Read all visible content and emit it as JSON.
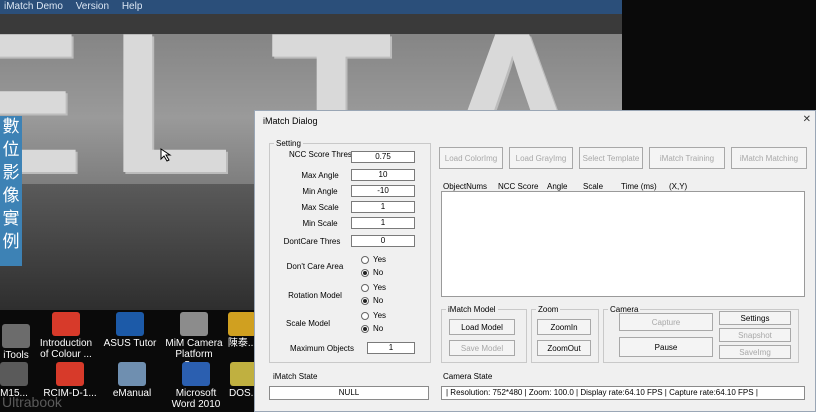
{
  "main_window": {
    "menu": [
      "iMatch Demo",
      "Version",
      "Help"
    ],
    "chinese_banner": [
      "數",
      "位",
      "影",
      "像",
      "實",
      "例"
    ],
    "camera_letters": [
      "E",
      "L",
      "T",
      "A"
    ]
  },
  "desktop": {
    "icons": [
      {
        "label": "iTools"
      },
      {
        "label": "Introduction of Colour ..."
      },
      {
        "label": "ASUS Tutor"
      },
      {
        "label": "MiM Camera Platform Se..."
      },
      {
        "label": "陳泰..."
      },
      {
        "label": "M15..."
      },
      {
        "label": "RCIM-D-1..."
      },
      {
        "label": "eManual"
      },
      {
        "label": "Microsoft Word 2010"
      },
      {
        "label": "DOS..."
      }
    ],
    "brand": "Ultrabook"
  },
  "dialog": {
    "title": "iMatch Dialog",
    "close_glyph": "✕",
    "setting": {
      "legend": "Setting",
      "fields": [
        {
          "label": "NCC Score Threshold",
          "value": "0.75"
        },
        {
          "label": "Max Angle",
          "value": "10"
        },
        {
          "label": "Min Angle",
          "value": "-10"
        },
        {
          "label": "Max Scale",
          "value": "1"
        },
        {
          "label": "Min Scale",
          "value": "1"
        },
        {
          "label": "DontCare Thres",
          "value": "0"
        }
      ],
      "radios": [
        {
          "label": "Don't Care Area",
          "yes": "Yes",
          "no": "No",
          "selected": "No"
        },
        {
          "label": "Rotation Model",
          "yes": "Yes",
          "no": "No",
          "selected": "No"
        },
        {
          "label": "Scale Model",
          "yes": "Yes",
          "no": "No",
          "selected": "No"
        }
      ],
      "max_objects_label": "Maximum Objects",
      "max_objects_value": "1"
    },
    "top_buttons": [
      "Load ColorImg",
      "Load GrayImg",
      "Select Template",
      "iMatch Training",
      "iMatch Matching"
    ],
    "results_headers": [
      "ObjectNums",
      "NCC Score",
      "Angle",
      "Scale",
      "Time (ms)",
      "(X,Y)"
    ],
    "imatch_model": {
      "legend": "iMatch Model",
      "load": "Load Model",
      "save": "Save Model"
    },
    "zoom": {
      "legend": "Zoom",
      "zoom_in": "ZoomIn",
      "zoom_out": "ZoomOut"
    },
    "camera": {
      "legend": "Camera",
      "capture": "Capture",
      "pause": "Pause",
      "settings": "Settings",
      "snapshot": "Snapshot",
      "saveimg": "SaveImg"
    },
    "imatch_state": {
      "label": "iMatch State",
      "value": "NULL"
    },
    "camera_state": {
      "label": "Camera State",
      "value": "| Resolution: 752*480 | Zoom: 100.0 | Display rate:64.10 FPS | Capture rate:64.10 FPS |"
    }
  },
  "colors": {
    "title_bar": "#2b4f7a",
    "chinese_banner": "#3d82b5",
    "dialog_bg": "#f0f0f0"
  }
}
